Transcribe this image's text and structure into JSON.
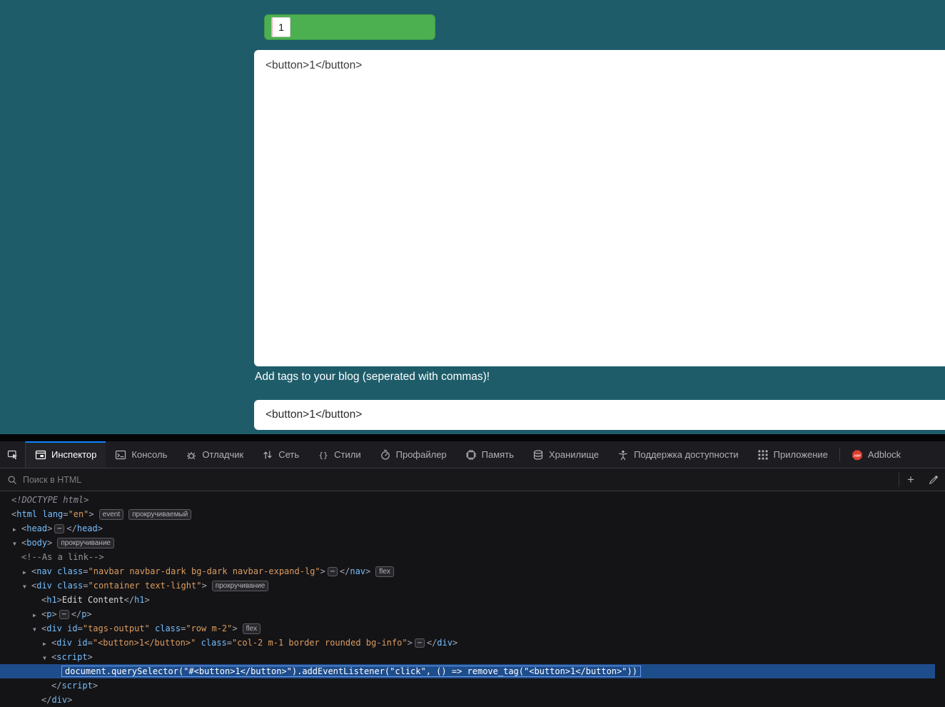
{
  "colors": {
    "page_background": "#1e5c6a",
    "tag_green": "#4caf50",
    "accent_blue": "#0a84ff",
    "selection_blue": "#1e4d8c",
    "tag_blue": "#75bfff",
    "value_orange": "#dd9c5e"
  },
  "page": {
    "tag_chip": {
      "button_label": "1"
    },
    "textarea_value": "<button>1</button>",
    "tags_label": "Add tags to your blog (seperated with commas)!",
    "input_value": "<button>1</button>"
  },
  "devtools": {
    "tabs": [
      {
        "id": "inspector",
        "label": "Инспектор",
        "icon": "inspector-icon",
        "active": true
      },
      {
        "id": "console",
        "label": "Консоль",
        "icon": "console-icon"
      },
      {
        "id": "debugger",
        "label": "Отладчик",
        "icon": "debugger-icon"
      },
      {
        "id": "network",
        "label": "Сеть",
        "icon": "network-icon"
      },
      {
        "id": "styles",
        "label": "Стили",
        "icon": "styles-icon"
      },
      {
        "id": "profiler",
        "label": "Профайлер",
        "icon": "profiler-icon"
      },
      {
        "id": "memory",
        "label": "Память",
        "icon": "memory-icon"
      },
      {
        "id": "storage",
        "label": "Хранилище",
        "icon": "storage-icon"
      },
      {
        "id": "accessibility",
        "label": "Поддержка доступности",
        "icon": "accessibility-icon"
      },
      {
        "id": "application",
        "label": "Приложение",
        "icon": "application-icon"
      },
      {
        "id": "abp",
        "label": "Adblock",
        "icon": "abp-icon",
        "separator_before": true
      }
    ],
    "search": {
      "placeholder": "Поиск в HTML"
    },
    "tree": [
      {
        "name": "doctype",
        "indent": 0,
        "twisty": null,
        "parts": [
          {
            "t": "doctype",
            "v": "<!DOCTYPE html>"
          }
        ]
      },
      {
        "name": "html-element",
        "indent": 0,
        "twisty": null,
        "parts": [
          {
            "t": "punct",
            "v": "<"
          },
          {
            "t": "tag",
            "v": "html"
          },
          {
            "t": "attr",
            "v": " lang"
          },
          {
            "t": "punct",
            "v": "="
          },
          {
            "t": "value",
            "v": "\"en\""
          },
          {
            "t": "punct",
            "v": ">"
          },
          {
            "t": "badge",
            "v": "event"
          },
          {
            "t": "badge",
            "v": "прокручиваемый"
          }
        ]
      },
      {
        "name": "head-element",
        "indent": 1,
        "twisty": "closed",
        "parts": [
          {
            "t": "punct",
            "v": "<"
          },
          {
            "t": "tag",
            "v": "head"
          },
          {
            "t": "punct",
            "v": ">"
          },
          {
            "t": "ellipsis",
            "v": "⋯"
          },
          {
            "t": "punct",
            "v": "</"
          },
          {
            "t": "tag",
            "v": "head"
          },
          {
            "t": "punct",
            "v": ">"
          }
        ]
      },
      {
        "name": "body-element",
        "indent": 1,
        "twisty": "open",
        "parts": [
          {
            "t": "punct",
            "v": "<"
          },
          {
            "t": "tag",
            "v": "body"
          },
          {
            "t": "punct",
            "v": ">"
          },
          {
            "t": "badge",
            "v": "прокручивание"
          }
        ]
      },
      {
        "name": "comment-node",
        "indent": 2,
        "twisty": null,
        "no_gutter": true,
        "parts": [
          {
            "t": "comment",
            "v": "<!--As a link-->"
          }
        ]
      },
      {
        "name": "nav-element",
        "indent": 2,
        "twisty": "closed",
        "parts": [
          {
            "t": "punct",
            "v": "<"
          },
          {
            "t": "tag",
            "v": "nav"
          },
          {
            "t": "attr",
            "v": " class"
          },
          {
            "t": "punct",
            "v": "="
          },
          {
            "t": "value",
            "v": "\"navbar navbar-dark bg-dark navbar-expand-lg\""
          },
          {
            "t": "punct",
            "v": ">"
          },
          {
            "t": "ellipsis",
            "v": "⋯"
          },
          {
            "t": "punct",
            "v": "</"
          },
          {
            "t": "tag",
            "v": "nav"
          },
          {
            "t": "punct",
            "v": ">"
          },
          {
            "t": "badge",
            "v": "flex"
          }
        ]
      },
      {
        "name": "container-div",
        "indent": 2,
        "twisty": "open",
        "parts": [
          {
            "t": "punct",
            "v": "<"
          },
          {
            "t": "tag",
            "v": "div"
          },
          {
            "t": "attr",
            "v": " class"
          },
          {
            "t": "punct",
            "v": "="
          },
          {
            "t": "value",
            "v": "\"container text-light\""
          },
          {
            "t": "punct",
            "v": ">"
          },
          {
            "t": "badge",
            "v": "прокручивание"
          }
        ]
      },
      {
        "name": "h1-element",
        "indent": 3,
        "twisty": null,
        "parts": [
          {
            "t": "punct",
            "v": "<"
          },
          {
            "t": "tag",
            "v": "h1"
          },
          {
            "t": "punct",
            "v": ">"
          },
          {
            "t": "text",
            "v": "Edit Content"
          },
          {
            "t": "punct",
            "v": "</"
          },
          {
            "t": "tag",
            "v": "h1"
          },
          {
            "t": "punct",
            "v": ">"
          }
        ]
      },
      {
        "name": "p-element",
        "indent": 3,
        "twisty": "closed",
        "parts": [
          {
            "t": "punct",
            "v": "<"
          },
          {
            "t": "tag",
            "v": "p"
          },
          {
            "t": "punct",
            "v": ">"
          },
          {
            "t": "ellipsis",
            "v": "⋯"
          },
          {
            "t": "punct",
            "v": "</"
          },
          {
            "t": "tag",
            "v": "p"
          },
          {
            "t": "punct",
            "v": ">"
          }
        ]
      },
      {
        "name": "tags-output-div",
        "indent": 3,
        "twisty": "open",
        "parts": [
          {
            "t": "punct",
            "v": "<"
          },
          {
            "t": "tag",
            "v": "div"
          },
          {
            "t": "attr",
            "v": " id"
          },
          {
            "t": "punct",
            "v": "="
          },
          {
            "t": "value",
            "v": "\"tags-output\""
          },
          {
            "t": "attr",
            "v": " class"
          },
          {
            "t": "punct",
            "v": "="
          },
          {
            "t": "value",
            "v": "\"row m-2\""
          },
          {
            "t": "punct",
            "v": ">"
          },
          {
            "t": "badge",
            "v": "flex"
          }
        ]
      },
      {
        "name": "tag-div",
        "indent": 4,
        "twisty": "closed",
        "parts": [
          {
            "t": "punct",
            "v": "<"
          },
          {
            "t": "tag",
            "v": "div"
          },
          {
            "t": "attr",
            "v": " id"
          },
          {
            "t": "punct",
            "v": "="
          },
          {
            "t": "value",
            "v": "\"<button>1</button>\""
          },
          {
            "t": "attr",
            "v": " class"
          },
          {
            "t": "punct",
            "v": "="
          },
          {
            "t": "value",
            "v": "\"col-2 m-1 border rounded bg-info\""
          },
          {
            "t": "punct",
            "v": ">"
          },
          {
            "t": "ellipsis",
            "v": "⋯"
          },
          {
            "t": "punct",
            "v": "</"
          },
          {
            "t": "tag",
            "v": "div"
          },
          {
            "t": "punct",
            "v": ">"
          }
        ]
      },
      {
        "name": "script-element",
        "indent": 4,
        "twisty": "open",
        "parts": [
          {
            "t": "punct",
            "v": "<"
          },
          {
            "t": "tag",
            "v": "script"
          },
          {
            "t": "punct",
            "v": ">"
          }
        ]
      },
      {
        "name": "script-text",
        "indent": 5,
        "twisty": null,
        "selected": true,
        "parts": [
          {
            "t": "code",
            "v": "document.querySelector(\"#<button>1</button>\").addEventListener(\"click\", () => remove_tag(\"<button>1</button>\"))"
          }
        ]
      },
      {
        "name": "script-close",
        "indent": 4,
        "twisty": null,
        "parts": [
          {
            "t": "punct",
            "v": "</"
          },
          {
            "t": "tag",
            "v": "script"
          },
          {
            "t": "punct",
            "v": ">"
          }
        ]
      },
      {
        "name": "tags-output-close",
        "indent": 3,
        "twisty": null,
        "parts": [
          {
            "t": "punct",
            "v": "</"
          },
          {
            "t": "tag",
            "v": "div"
          },
          {
            "t": "punct",
            "v": ">"
          }
        ]
      }
    ]
  }
}
